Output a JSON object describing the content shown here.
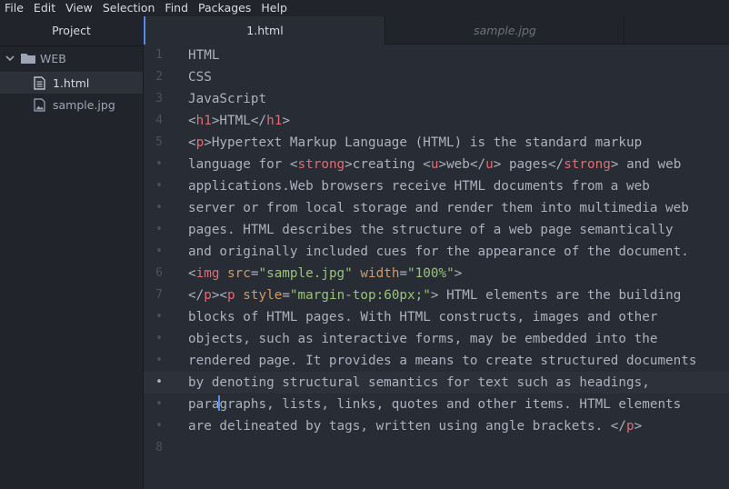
{
  "menu": [
    "File",
    "Edit",
    "View",
    "Selection",
    "Find",
    "Packages",
    "Help"
  ],
  "sidebar": {
    "title": "Project",
    "folder": "WEB",
    "files": [
      {
        "name": "1.html",
        "icon": "file-text-icon",
        "selected": true
      },
      {
        "name": "sample.jpg",
        "icon": "image-file-icon",
        "selected": false
      }
    ]
  },
  "tabs": [
    {
      "label": "1.html",
      "active": true
    },
    {
      "label": "sample.jpg",
      "active": false
    }
  ],
  "colors": {
    "background": "#282c34",
    "panel": "#21252b",
    "tag": "#e06c75",
    "attribute": "#d19a66",
    "string": "#98c379",
    "text": "#abb2bf",
    "accent": "#568af2"
  },
  "editor": {
    "cursor_line_index": 15,
    "lines": [
      {
        "gutter": "1",
        "segments": [
          {
            "c": "p",
            "t": "HTML"
          }
        ]
      },
      {
        "gutter": "2",
        "segments": [
          {
            "c": "p",
            "t": "CSS"
          }
        ]
      },
      {
        "gutter": "3",
        "segments": [
          {
            "c": "p",
            "t": "JavaScript"
          }
        ]
      },
      {
        "gutter": "4",
        "segments": [
          {
            "c": "p",
            "t": "<"
          },
          {
            "c": "t",
            "t": "h1"
          },
          {
            "c": "p",
            "t": ">HTML</"
          },
          {
            "c": "t",
            "t": "h1"
          },
          {
            "c": "p",
            "t": ">"
          }
        ]
      },
      {
        "gutter": "5",
        "segments": [
          {
            "c": "p",
            "t": "<"
          },
          {
            "c": "t",
            "t": "p"
          },
          {
            "c": "p",
            "t": ">Hypertext Markup Language (HTML) is the standard markup"
          }
        ]
      },
      {
        "gutter": "•",
        "segments": [
          {
            "c": "p",
            "t": "language for <"
          },
          {
            "c": "t",
            "t": "strong"
          },
          {
            "c": "p",
            "t": ">creating <"
          },
          {
            "c": "t",
            "t": "u"
          },
          {
            "c": "p",
            "t": ">web</"
          },
          {
            "c": "t",
            "t": "u"
          },
          {
            "c": "p",
            "t": "> pages</"
          },
          {
            "c": "t",
            "t": "strong"
          },
          {
            "c": "p",
            "t": "> and web"
          }
        ]
      },
      {
        "gutter": "•",
        "segments": [
          {
            "c": "p",
            "t": "applications.Web browsers receive HTML documents from a web"
          }
        ]
      },
      {
        "gutter": "•",
        "segments": [
          {
            "c": "p",
            "t": "server or from local storage and render them into multimedia web"
          }
        ]
      },
      {
        "gutter": "•",
        "segments": [
          {
            "c": "p",
            "t": "pages. HTML describes the structure of a web page semantically"
          }
        ]
      },
      {
        "gutter": "•",
        "segments": [
          {
            "c": "p",
            "t": "and originally included cues for the appearance of the document."
          }
        ]
      },
      {
        "gutter": "6",
        "segments": [
          {
            "c": "p",
            "t": "<"
          },
          {
            "c": "t",
            "t": "img"
          },
          {
            "c": "p",
            "t": " "
          },
          {
            "c": "a",
            "t": "src"
          },
          {
            "c": "p",
            "t": "="
          },
          {
            "c": "s",
            "t": "\"sample.jpg\""
          },
          {
            "c": "p",
            "t": " "
          },
          {
            "c": "a",
            "t": "width"
          },
          {
            "c": "p",
            "t": "="
          },
          {
            "c": "s",
            "t": "\"100%\""
          },
          {
            "c": "p",
            "t": ">"
          }
        ]
      },
      {
        "gutter": "7",
        "segments": [
          {
            "c": "p",
            "t": "</"
          },
          {
            "c": "t",
            "t": "p"
          },
          {
            "c": "p",
            "t": "><"
          },
          {
            "c": "t",
            "t": "p"
          },
          {
            "c": "p",
            "t": " "
          },
          {
            "c": "a",
            "t": "style"
          },
          {
            "c": "p",
            "t": "="
          },
          {
            "c": "s",
            "t": "\"margin-top:60px;\""
          },
          {
            "c": "p",
            "t": "> HTML elements are the building"
          }
        ]
      },
      {
        "gutter": "•",
        "segments": [
          {
            "c": "p",
            "t": "blocks of HTML pages. With HTML constructs, images and other"
          }
        ]
      },
      {
        "gutter": "•",
        "segments": [
          {
            "c": "p",
            "t": "objects, such as interactive forms, may be embedded into the"
          }
        ]
      },
      {
        "gutter": "•",
        "segments": [
          {
            "c": "p",
            "t": "rendered page. It provides a means to create structured documents"
          }
        ]
      },
      {
        "gutter": "•",
        "segments": [
          {
            "c": "p",
            "t": "by denoting structural semantics for text such as headings,"
          }
        ]
      },
      {
        "gutter": "•",
        "segments": [
          {
            "c": "p",
            "t": "para"
          },
          {
            "c": "caret",
            "t": ""
          },
          {
            "c": "p",
            "t": "graphs, lists, links, quotes and other items. HTML elements"
          }
        ]
      },
      {
        "gutter": "•",
        "segments": [
          {
            "c": "p",
            "t": "are delineated by tags, written using angle brackets. </"
          },
          {
            "c": "t",
            "t": "p"
          },
          {
            "c": "p",
            "t": ">"
          }
        ]
      },
      {
        "gutter": "8",
        "segments": []
      }
    ]
  }
}
